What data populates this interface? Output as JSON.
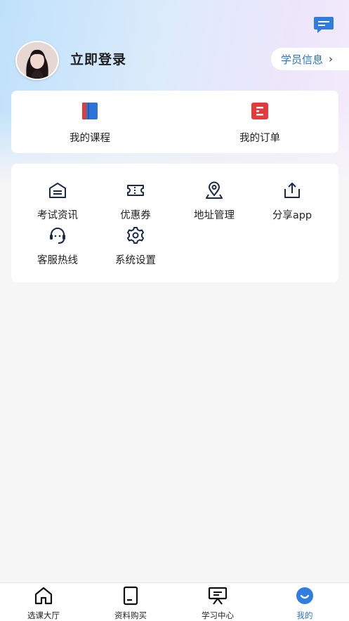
{
  "header": {
    "login_label": "立即登录",
    "student_info_label": "学员信息",
    "chevron": "›",
    "icons": {
      "message": "chat-message-icon",
      "avatar": "avatar"
    }
  },
  "quick_links": [
    {
      "label": "我的课程",
      "icon": "book-icon",
      "color": "#2b73d4"
    },
    {
      "label": "我的订单",
      "icon": "order-icon",
      "color": "#e23b3b"
    }
  ],
  "services": [
    {
      "label": "考试资讯",
      "icon": "exam-info-icon"
    },
    {
      "label": "优惠券",
      "icon": "coupon-icon"
    },
    {
      "label": "地址管理",
      "icon": "location-icon"
    },
    {
      "label": "分享app",
      "icon": "share-icon"
    },
    {
      "label": "客服热线",
      "icon": "customer-service-icon"
    },
    {
      "label": "系统设置",
      "icon": "settings-icon"
    }
  ],
  "tabbar": {
    "items": [
      {
        "label": "选课大厅",
        "icon": "home-icon"
      },
      {
        "label": "资料购买",
        "icon": "document-icon"
      },
      {
        "label": "学习中心",
        "icon": "presentation-icon"
      },
      {
        "label": "我的",
        "icon": "profile-icon",
        "active": true
      }
    ]
  },
  "colors": {
    "accent": "#2b73c8",
    "card": "#ffffff",
    "background": "#f6f6f7"
  }
}
